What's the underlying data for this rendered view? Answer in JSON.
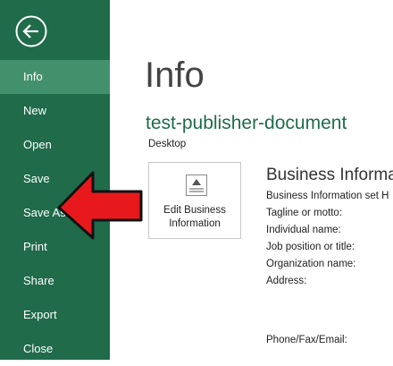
{
  "sidebar": {
    "back_icon": "back-arrow-circle-icon",
    "items": [
      {
        "label": "Info",
        "active": true
      },
      {
        "label": "New"
      },
      {
        "label": "Open"
      },
      {
        "label": "Save"
      },
      {
        "label": "Save As"
      },
      {
        "label": "Print"
      },
      {
        "label": "Share"
      },
      {
        "label": "Export"
      },
      {
        "label": "Close"
      }
    ]
  },
  "main": {
    "title": "Info",
    "document_name": "test-publisher-document",
    "location": "Desktop",
    "edit_card": {
      "line1": "Edit Business",
      "line2": "Information",
      "icon": "business-card-icon"
    },
    "business_info": {
      "title": "Business Informat",
      "fields": [
        "Business Information set H",
        "Tagline or motto:",
        "Individual name:",
        "Job position or title:",
        "Organization name:",
        "Address:",
        "Phone/Fax/Email:"
      ]
    }
  },
  "annotation": {
    "arrow_color": "#e8191c",
    "icon": "red-arrow-icon"
  },
  "colors": {
    "sidebar": "#1f6b4a",
    "active_item": "#43916c",
    "accent": "#1f6b4a"
  }
}
